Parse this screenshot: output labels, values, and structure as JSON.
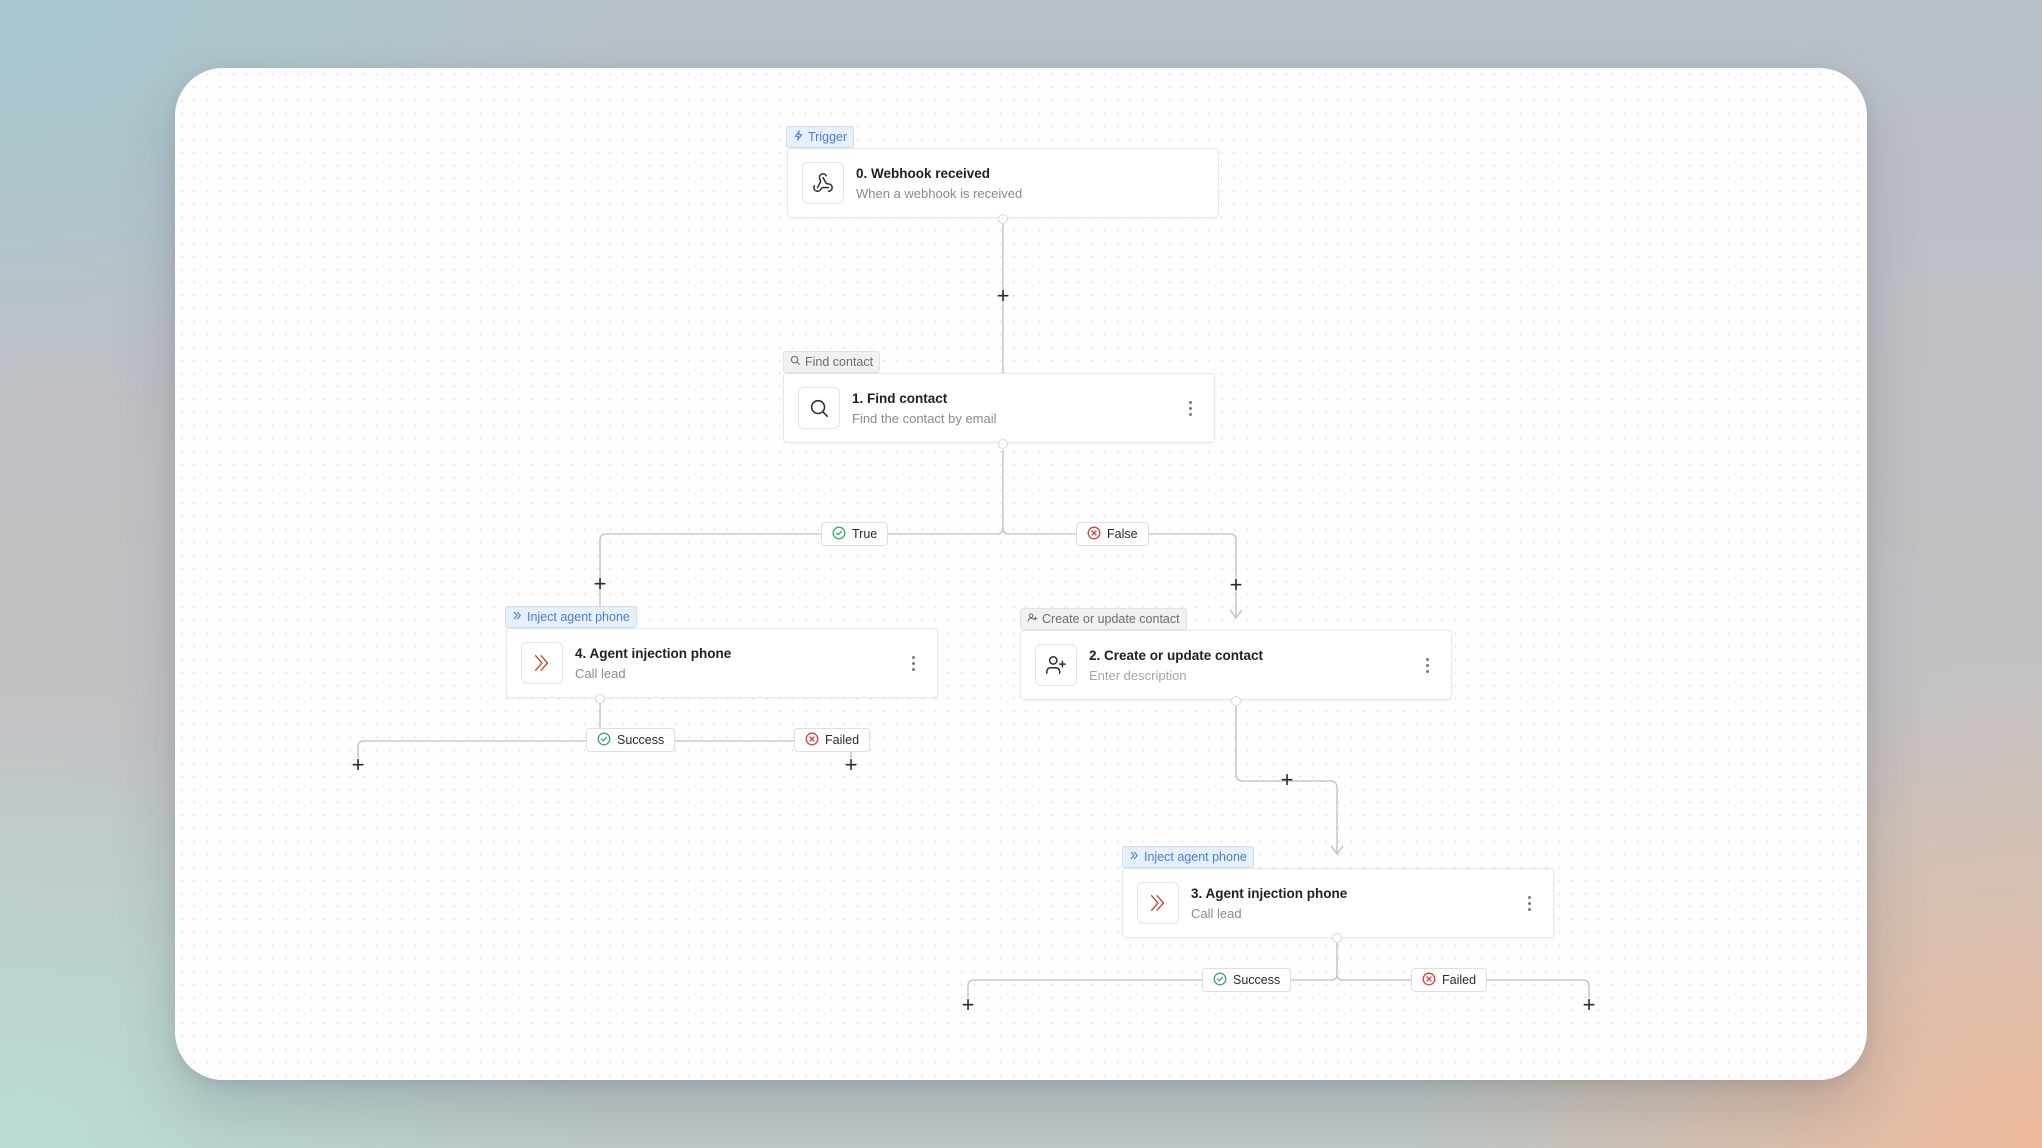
{
  "colors": {
    "accent_blue": "#4b7fd6",
    "success": "#3aa864",
    "failed": "#d9443c",
    "agent": "#c2502f"
  },
  "nodes": {
    "webhook": {
      "tag": "Trigger",
      "tag_icon": "bolt-icon",
      "title": "0. Webhook received",
      "subtitle": "When a webhook is received",
      "icon": "webhook-icon"
    },
    "find_contact": {
      "tag": "Find contact",
      "tag_icon": "search-icon",
      "title": "1. Find contact",
      "subtitle": "Find the contact by email",
      "icon": "search-icon"
    },
    "create_contact": {
      "tag": "Create or update contact",
      "tag_icon": "user-plus-icon",
      "title": "2. Create or update contact",
      "subtitle": "Enter description",
      "icon": "user-plus-icon"
    },
    "agent_3": {
      "tag": "Inject agent phone",
      "tag_icon": "chevrons-right-icon",
      "title": "3. Agent injection phone",
      "subtitle": "Call lead",
      "icon": "chevrons-right-icon"
    },
    "agent_4": {
      "tag": "Inject agent phone",
      "tag_icon": "chevrons-right-icon",
      "title": "4. Agent injection phone",
      "subtitle": "Call lead",
      "icon": "chevrons-right-icon"
    }
  },
  "branches": {
    "true_label": "True",
    "false_label": "False",
    "success_label": "Success",
    "failed_label": "Failed"
  },
  "add_step_symbol": "+"
}
